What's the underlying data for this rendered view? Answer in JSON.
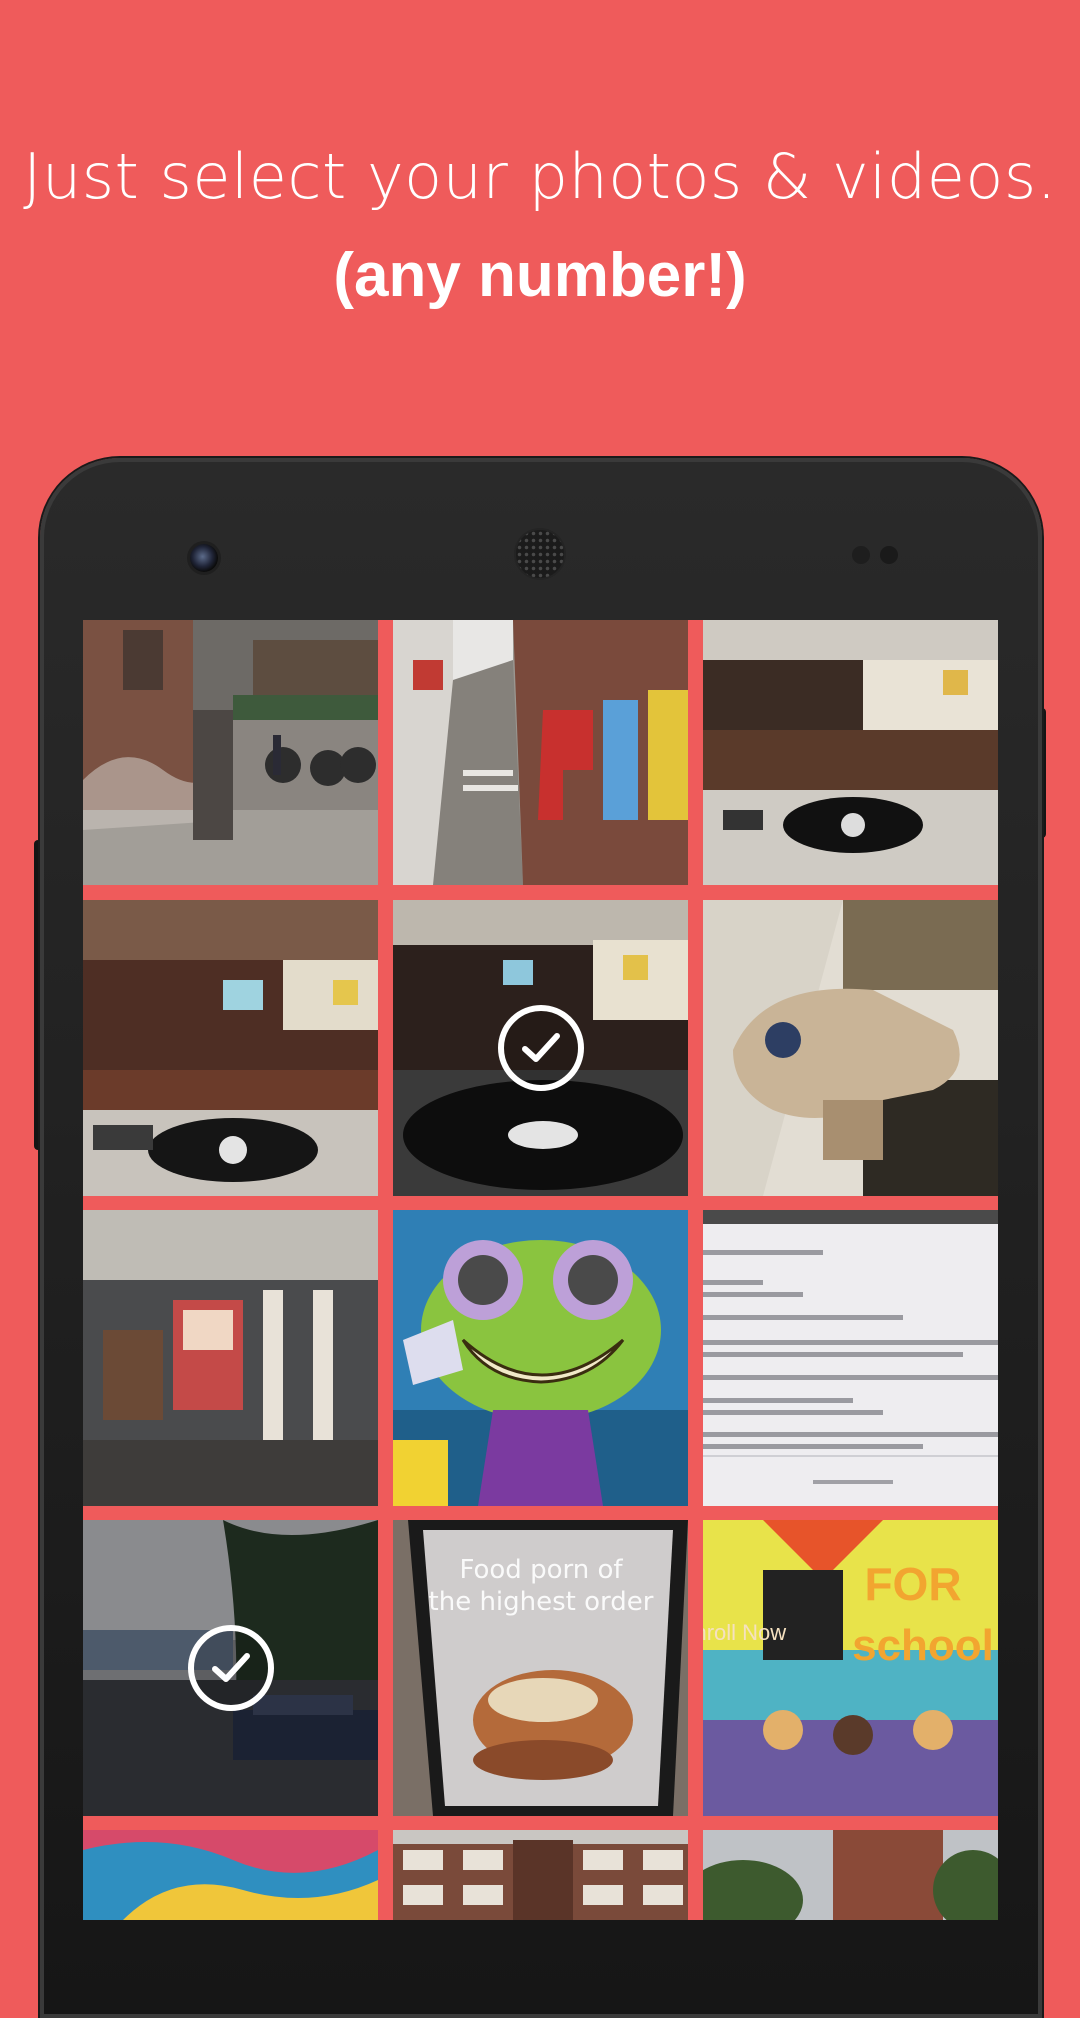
{
  "header": {
    "headline": "Just select your photos & videos.",
    "subheadline": "(any number!)"
  },
  "colors": {
    "background": "#ef5b5b",
    "text": "#ffffff",
    "phone_body": "#1c1c1c"
  },
  "photo_grid": {
    "tiles": [
      {
        "subject": "brick alley with parked bicycles",
        "selected": false
      },
      {
        "subject": "graffiti wall in narrow alley",
        "selected": false
      },
      {
        "subject": "record shop interior with turntable",
        "selected": false
      },
      {
        "subject": "record shop interior with turntable",
        "selected": false
      },
      {
        "subject": "turntable close-up",
        "selected": true
      },
      {
        "subject": "millennium falcon model",
        "selected": false
      },
      {
        "subject": "covered walkway at night",
        "selected": false
      },
      {
        "subject": "green alien street art",
        "selected": false
      },
      {
        "subject": "screen with document text",
        "selected": false
      },
      {
        "subject": "canal with boat at dusk",
        "selected": true
      },
      {
        "subject": "food poster sign",
        "selected": false
      },
      {
        "subject": "colorful school mural",
        "selected": false
      },
      {
        "subject": "colorful street art",
        "selected": false
      },
      {
        "subject": "apartment block",
        "selected": false
      },
      {
        "subject": "brick building and trees",
        "selected": false
      }
    ],
    "tile_texts": {
      "food_poster": "Food porn of the highest order",
      "mural_for": "FOR",
      "mural_school": "school",
      "mural_enroll": "Enroll Now"
    }
  },
  "icons": {
    "check": "checkmark-circle-icon",
    "camera": "front-camera-icon",
    "speaker": "earpiece-speaker-icon"
  }
}
